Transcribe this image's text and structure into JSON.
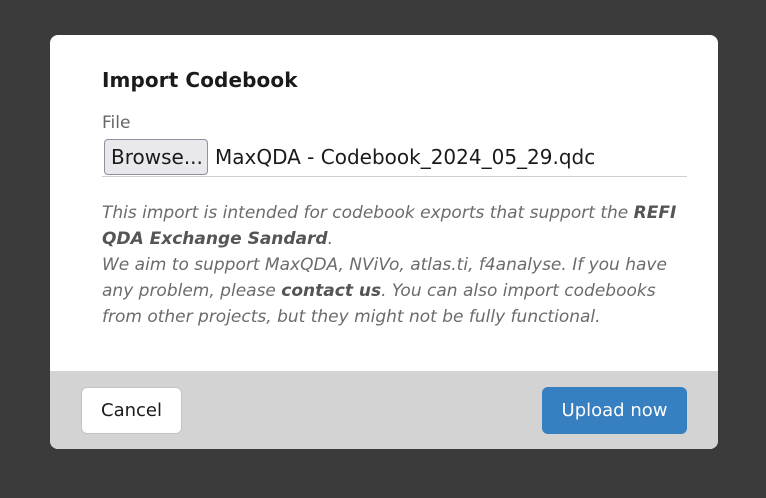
{
  "dialog": {
    "title": "Import Codebook",
    "file_label": "File",
    "browse_label": "Browse...",
    "file_name": "MaxQDA - Codebook_2024_05_29.qdc",
    "help": {
      "p1_before": "This import is intended for codebook exports that support the ",
      "p1_bold": "REFI QDA Exchange Sandard",
      "p1_after": ".",
      "p2_before": "We aim to support MaxQDA, NViVo, atlas.ti, f4analyse. If you have any problem, please ",
      "p2_link": "contact us",
      "p2_after": ". You can also import codebooks from other projects, but they might not be fully functional."
    },
    "cancel_label": "Cancel",
    "upload_label": "Upload now"
  },
  "colors": {
    "backdrop": "#3b3b3b",
    "footer": "#d3d3d3",
    "primary": "#2e7bbf"
  }
}
